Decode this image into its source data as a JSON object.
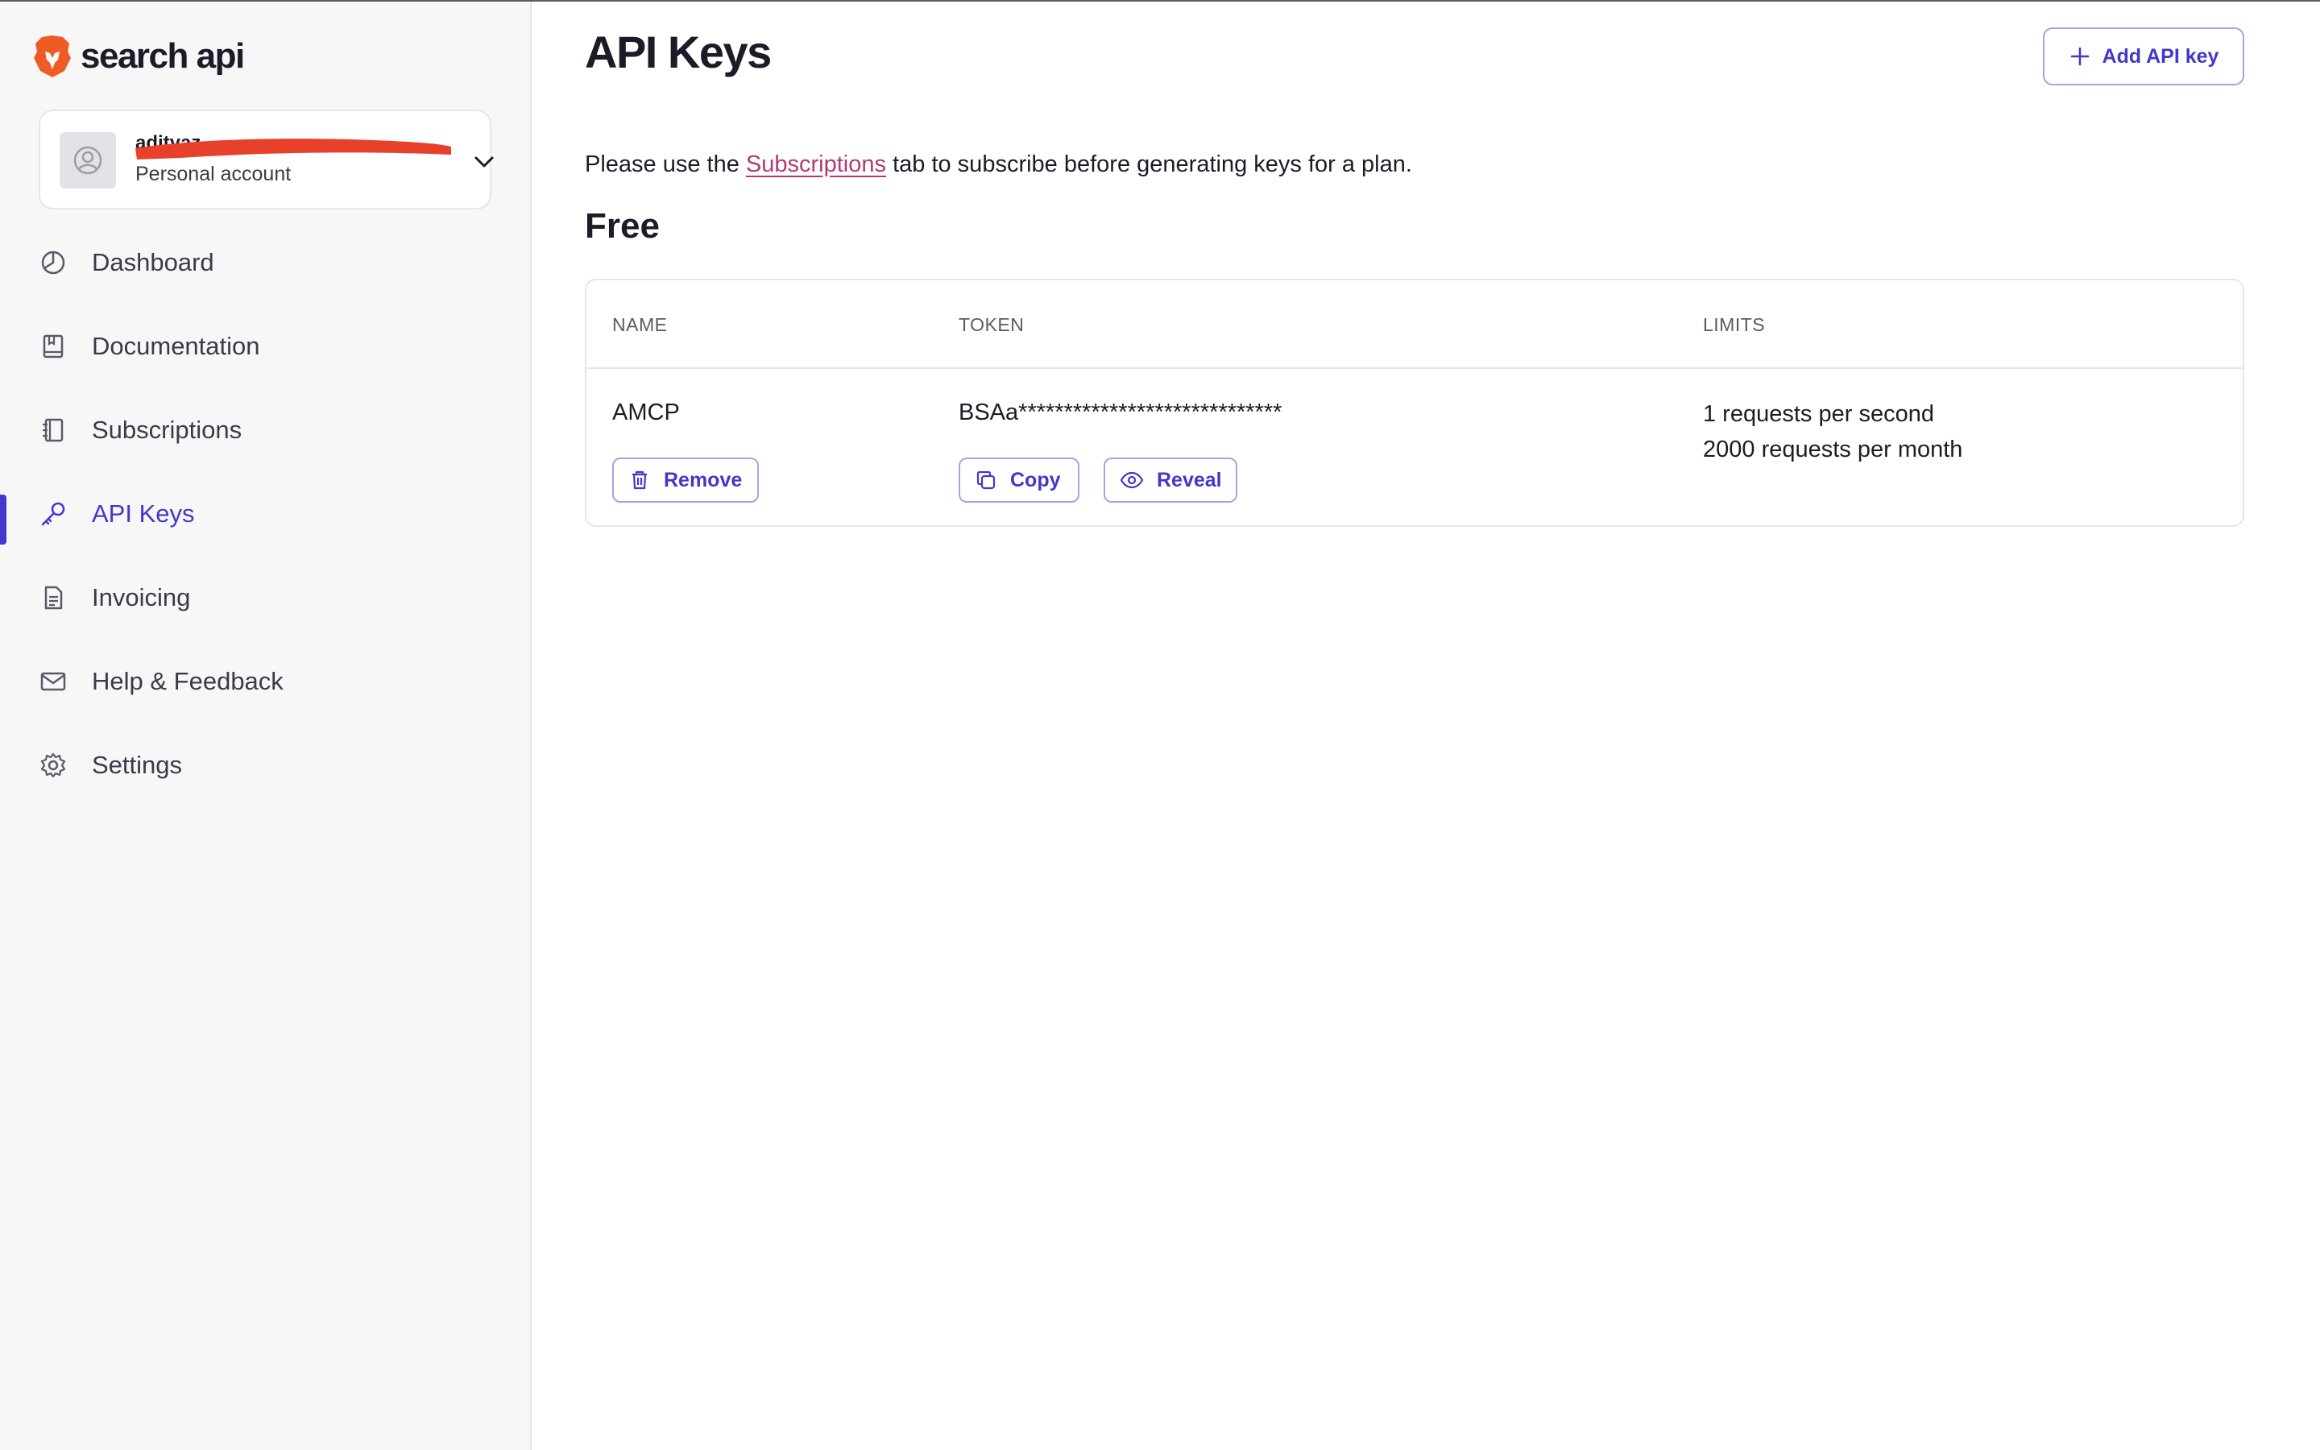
{
  "brand": {
    "name": "search api"
  },
  "account": {
    "email": "adityaz",
    "type": "Personal account"
  },
  "nav": {
    "items": [
      {
        "label": "Dashboard"
      },
      {
        "label": "Documentation"
      },
      {
        "label": "Subscriptions"
      },
      {
        "label": "API Keys",
        "active": true
      },
      {
        "label": "Invoicing"
      },
      {
        "label": "Help & Feedback"
      },
      {
        "label": "Settings"
      }
    ]
  },
  "main": {
    "title": "API Keys",
    "add_button_label": "Add API key",
    "notice": {
      "before": "Please use the ",
      "link": "Subscriptions",
      "after": " tab to subscribe before generating keys for a plan."
    },
    "plan_title": "Free",
    "table": {
      "headers": [
        "NAME",
        "TOKEN",
        "LIMITS"
      ],
      "rows": [
        {
          "name": "AMCP",
          "token": "BSAa*****************************",
          "limits": [
            "1 requests per second",
            "2000 requests per month"
          ],
          "remove_label": "Remove",
          "copy_label": "Copy",
          "reveal_label": "Reveal"
        }
      ]
    }
  },
  "colors": {
    "accent": "#4338ca",
    "link": "#b03a78",
    "brand_orange": "#f05a24",
    "redaction": "#e8412b"
  }
}
